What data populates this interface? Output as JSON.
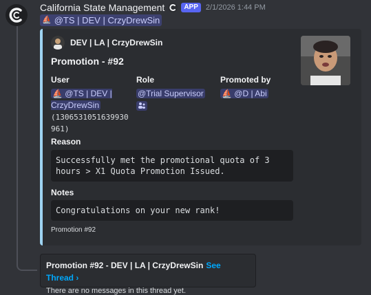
{
  "message": {
    "username": "California State Management",
    "app_badge": "APP",
    "timestamp": "2/1/2026 1:44 PM",
    "mention": "@TS | DEV | CrzyDrewSin"
  },
  "embed": {
    "accent_color": "#9ed3f2",
    "author": "DEV | LA | CrzyDrewSin",
    "title": "Promotion - #92",
    "fields": {
      "user": {
        "name": "User",
        "mention": "@TS | DEV | CrzyDrewSin",
        "id": "(1306531051639930961)"
      },
      "role": {
        "name": "Role",
        "mention": "@Trial Supervisor"
      },
      "promoted_by": {
        "name": "Promoted by",
        "mention": "@D | Abi"
      },
      "reason": {
        "name": "Reason",
        "value": "Successfully met the promotional quota of 3 hours > X1 Quota Promotion Issued."
      },
      "notes": {
        "name": "Notes",
        "value": "Congratulations on your new rank!"
      }
    },
    "footer": "Promotion #92"
  },
  "thread": {
    "title": "Promotion #92 - DEV | LA | CrzyDrewSin",
    "link": "See Thread ›",
    "status": "There are no messages in this thread yet."
  }
}
